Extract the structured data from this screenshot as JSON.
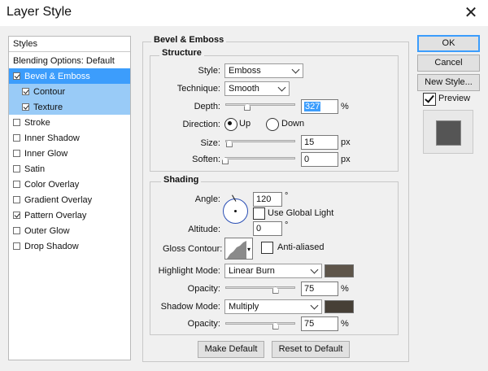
{
  "window": {
    "title": "Layer Style",
    "close_glyph": "✕"
  },
  "styles_panel": {
    "header": "Styles",
    "blending": "Blending Options: Default",
    "items": [
      {
        "label": "Bevel & Emboss",
        "checked": true
      },
      {
        "label": "Contour",
        "checked": true
      },
      {
        "label": "Texture",
        "checked": true
      },
      {
        "label": "Stroke",
        "checked": false
      },
      {
        "label": "Inner Shadow",
        "checked": false
      },
      {
        "label": "Inner Glow",
        "checked": false
      },
      {
        "label": "Satin",
        "checked": false
      },
      {
        "label": "Color Overlay",
        "checked": false
      },
      {
        "label": "Gradient Overlay",
        "checked": false
      },
      {
        "label": "Pattern Overlay",
        "checked": true
      },
      {
        "label": "Outer Glow",
        "checked": false
      },
      {
        "label": "Drop Shadow",
        "checked": false
      }
    ]
  },
  "bevel": {
    "section_title": "Bevel & Emboss",
    "structure_title": "Structure",
    "style_label": "Style:",
    "style_value": "Emboss",
    "technique_label": "Technique:",
    "technique_value": "Smooth",
    "depth_label": "Depth:",
    "depth_value": "327",
    "depth_unit": "%",
    "depth_slider": 0.33,
    "direction_label": "Direction:",
    "dir_up": "Up",
    "dir_down": "Down",
    "size_label": "Size:",
    "size_value": "15",
    "size_unit": "px",
    "size_slider": 0.06,
    "soften_label": "Soften:",
    "soften_value": "0",
    "soften_unit": "px",
    "soften_slider": 0.0
  },
  "shading": {
    "title": "Shading",
    "angle_label": "Angle:",
    "angle_value": "120",
    "angle_unit": "°",
    "global_light": "Use Global Light",
    "altitude_label": "Altitude:",
    "altitude_value": "0",
    "altitude_unit": "°",
    "gloss_label": "Gloss Contour:",
    "antialiased": "Anti-aliased",
    "highlight_label": "Highlight Mode:",
    "highlight_mode": "Linear Burn",
    "highlight_color": "#5e554a",
    "hl_opacity_label": "Opacity:",
    "hl_opacity_value": "75",
    "hl_opacity_unit": "%",
    "hl_opacity_slider": 0.75,
    "shadow_label": "Shadow Mode:",
    "shadow_mode": "Multiply",
    "shadow_color": "#463f36",
    "sh_opacity_label": "Opacity:",
    "sh_opacity_value": "75",
    "sh_opacity_unit": "%",
    "sh_opacity_slider": 0.75
  },
  "footer": {
    "make_default": "Make Default",
    "reset_default": "Reset to Default"
  },
  "side_buttons": {
    "ok": "OK",
    "cancel": "Cancel",
    "new_style": "New Style...",
    "preview": "Preview",
    "preview_color": "#555555"
  }
}
